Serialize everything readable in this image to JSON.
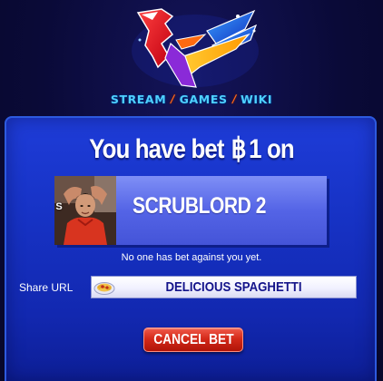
{
  "header": {
    "logo_icon": "stylized-falcon-logo-icon",
    "nav": [
      {
        "label": "STREAM"
      },
      {
        "label": "GAMES"
      },
      {
        "label": "WIKI"
      }
    ],
    "separator": "/"
  },
  "bet": {
    "title_prefix": "You have bet",
    "currency_symbol": "฿",
    "amount_text": "1 on",
    "opponent": {
      "name": "SCRUBLORD 2",
      "avatar_letter": "S",
      "avatar_icon": "user-photo-avatar"
    },
    "status": "No one has bet against you yet.",
    "share": {
      "label": "Share URL",
      "value": "DELICIOUS SPAGHETTI",
      "icon": "spaghetti-plate-icon"
    },
    "cancel_label": "CANCEL BET"
  },
  "colors": {
    "panel_blue": "#1733c6",
    "card_blue": "#5464e6",
    "nav_cyan": "#4fd0ff",
    "cancel_red": "#d42a1a",
    "share_text": "#14148a"
  }
}
